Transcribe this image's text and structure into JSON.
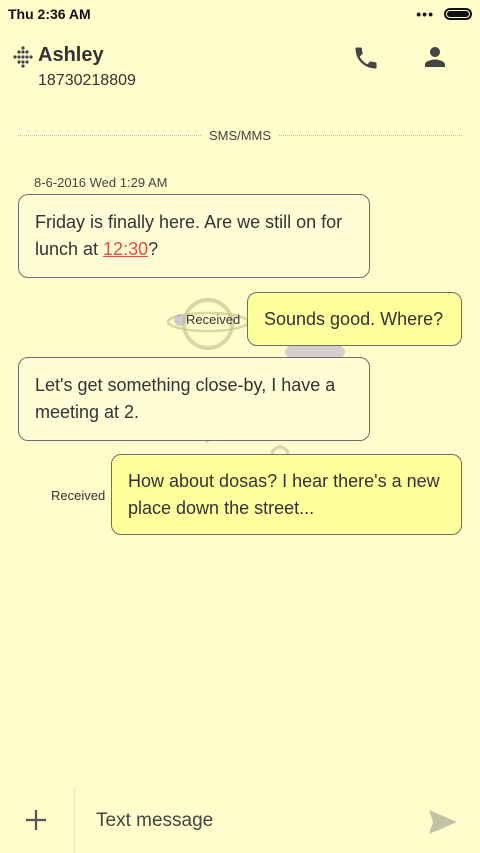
{
  "status_bar": {
    "time": "Thu 2:36 AM",
    "signal_icon": "more-dots-icon",
    "battery_icon": "battery-icon"
  },
  "header": {
    "contact_name": "Ashley",
    "contact_number": "18730218809",
    "icons": [
      "dotted-logo-icon",
      "phone-icon",
      "person-icon"
    ]
  },
  "thread": {
    "divider_label": "SMS/MMS",
    "timestamp": "8-6-2016 Wed 1:29 AM",
    "messages": [
      {
        "direction": "incoming",
        "text_before": "Friday is finally here. Are we still on for lunch at ",
        "link": "12:30",
        "text_after": "?"
      },
      {
        "direction": "outgoing",
        "text": "Sounds good. Where?",
        "status": "Received"
      },
      {
        "direction": "incoming",
        "text": "Let's get something close-by, I have a meeting at 2."
      },
      {
        "direction": "outgoing",
        "text": "How about dosas? I hear there's a new place down the street...",
        "status": "Received"
      }
    ]
  },
  "composer": {
    "placeholder": "Text message",
    "add_icon": "plus-icon",
    "send_icon": "send-icon"
  },
  "colors": {
    "background": "#fffdcc",
    "incoming_bubble": "#fffdd6",
    "outgoing_bubble": "#ffff9e",
    "link": "#e05040"
  }
}
